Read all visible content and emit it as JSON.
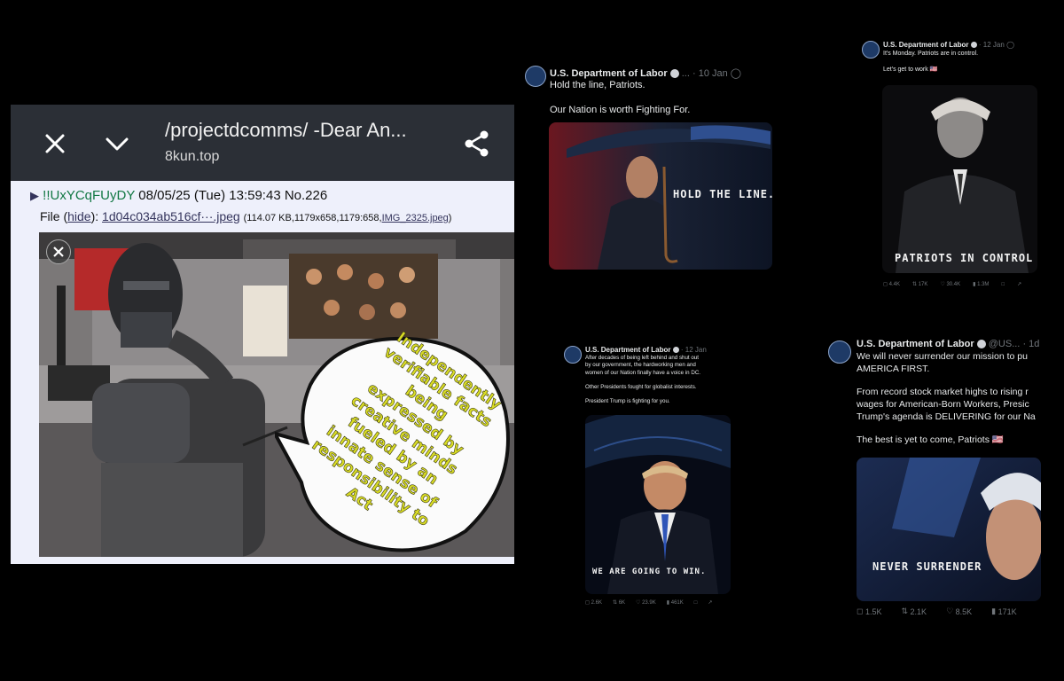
{
  "kun": {
    "title": "/projectdcomms/ -Dear An...",
    "host": "8kun.top",
    "post": {
      "triangle": "▶",
      "poster_id": "!!UxYCqFUyDY",
      "datetime": "08/05/25 (Tue) 13:59:43",
      "number": "No.226",
      "file_label": "File (",
      "hide_link": "hide",
      "file_sep": "):",
      "file_link": "1d04c034ab516cf···.jpeg",
      "file_meta": "(114.07 KB,1179x658,1179:658,",
      "file_orig": "IMG_2325.jpeg",
      "file_end": ")"
    },
    "bubble_lines": [
      "Independently",
      "verifiable facts",
      "being",
      "expressed by",
      "creative minds",
      "fueled by an",
      "innate sense of",
      "responsibility to",
      "Act"
    ]
  },
  "colors": {
    "kun_bar": "#2b2f36",
    "kun_post_bg": "#eef0fb",
    "poster_id": "#117743",
    "link": "#34345c",
    "bubble_text": "#d9dc25",
    "tweet_bg": "#000000",
    "muted": "#71767b"
  },
  "icons": {
    "close": "close-icon",
    "collapse": "chevron-down-icon",
    "share": "share-icon",
    "overlay_close": "close-icon",
    "grok": "grok-icon",
    "bookmark": "bookmark-icon",
    "reply": "reply-icon",
    "retweet": "retweet-icon",
    "like": "heart-icon",
    "views": "views-icon"
  },
  "tweets": [
    {
      "author": "U.S. Department of Labor",
      "more": "...",
      "time": "· 10 Jan",
      "lines": [
        "Hold the line, Patriots.",
        "",
        "Our Nation is worth Fighting For."
      ],
      "image_caption": "HOLD THE LINE."
    },
    {
      "author": "U.S. Department of Labor",
      "time": "· 12 Jan",
      "lines": [
        "It's Monday. Patriots are in control.",
        "",
        "Let's get to work 🇺🇸"
      ],
      "image_caption": "PATRIOTS IN CONTROL",
      "stats": {
        "replies": "4.4K",
        "retweets": "17K",
        "likes": "30.4K",
        "views": "1.3M"
      }
    },
    {
      "author": "U.S. Department of Labor",
      "time": "· 12 Jan",
      "lines": [
        "After decades of being left behind and shut out",
        "by our government, the hardworking men and",
        "women of our Nation finally have a voice in DC.",
        "",
        "Other Presidents fought for globalist interests.",
        "",
        "President Trump is fighting for you."
      ],
      "image_caption": "WE ARE GOING TO WIN.",
      "stats": {
        "replies": "2.6K",
        "retweets": "6K",
        "likes": "23.9K",
        "views": "461K"
      }
    },
    {
      "author": "U.S. Department of Labor",
      "handle": "@US...",
      "time": "· 1d",
      "lines": [
        "We will never surrender our mission to pu",
        "AMERICA FIRST.",
        "",
        "From record stock market highs to rising r",
        "wages for American-Born Workers, Presic",
        "Trump's agenda is DELIVERING for our Na",
        "",
        "The best is yet to come, Patriots 🇺🇸"
      ],
      "image_caption": "NEVER SURRENDER",
      "stats": {
        "replies": "1.5K",
        "retweets": "2.1K",
        "likes": "8.5K",
        "views": "171K"
      }
    }
  ]
}
